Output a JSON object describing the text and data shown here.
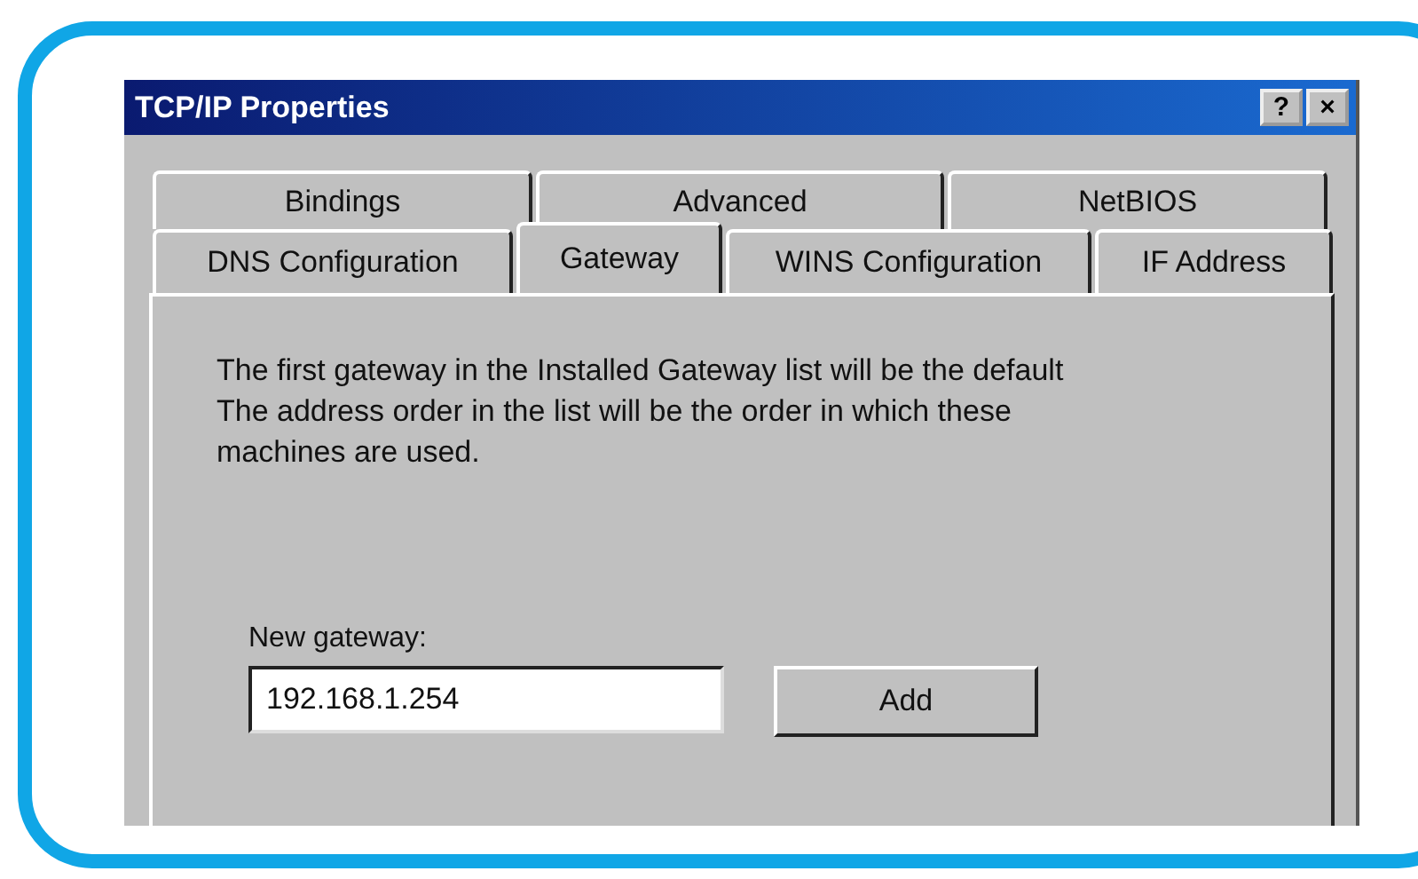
{
  "window": {
    "title": "TCP/IP Properties",
    "title_buttons": [
      "?",
      "×"
    ]
  },
  "tab_rows": [
    [
      {
        "label": "Bindings",
        "selected": false
      },
      {
        "label": "Advanced",
        "selected": false
      },
      {
        "label": "NetBIOS",
        "selected": false
      }
    ],
    [
      {
        "label": "DNS Configuration",
        "selected": false
      },
      {
        "label": "Gateway",
        "selected": true
      },
      {
        "label": "WINS Configuration",
        "selected": false
      },
      {
        "label": "IF Address",
        "selected": false
      }
    ]
  ],
  "description": [
    "The first gateway in the Installed Gateway list will be the default",
    "The address order in the list will be the order in which these",
    "machines are used."
  ],
  "new_gateway": {
    "label": "New gateway:",
    "value": "192.168.1.254"
  },
  "buttons": [
    "Add"
  ]
}
